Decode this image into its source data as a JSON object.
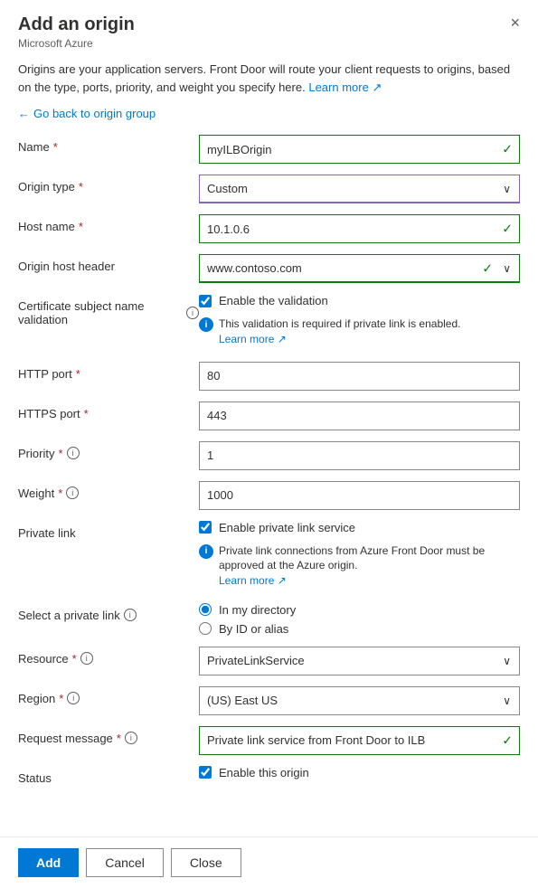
{
  "dialog": {
    "title": "Add an origin",
    "subtitle": "Microsoft Azure",
    "close_label": "×"
  },
  "description": {
    "text": "Origins are your application servers. Front Door will route your client requests to origins, based on the type, ports, priority, and weight you specify here.",
    "learn_more": "Learn more",
    "learn_more_icon": "↗"
  },
  "back_link": {
    "arrow": "←",
    "label": "Go back to origin group"
  },
  "form": {
    "name": {
      "label": "Name",
      "required": true,
      "value": "myILBOrigin"
    },
    "origin_type": {
      "label": "Origin type",
      "required": true,
      "value": "Custom"
    },
    "host_name": {
      "label": "Host name",
      "required": true,
      "value": "10.1.0.6"
    },
    "origin_host_header": {
      "label": "Origin host header",
      "required": false,
      "value": "www.contoso.com"
    },
    "cert_validation": {
      "label": "Certificate subject name validation",
      "has_info": true,
      "checkbox_label": "Enable the validation",
      "checked": true,
      "info_text": "This validation is required if private link is enabled.",
      "learn_more": "Learn more",
      "learn_more_icon": "↗"
    },
    "http_port": {
      "label": "HTTP port",
      "required": true,
      "value": "80"
    },
    "https_port": {
      "label": "HTTPS port",
      "required": true,
      "value": "443"
    },
    "priority": {
      "label": "Priority",
      "required": true,
      "has_info": true,
      "value": "1"
    },
    "weight": {
      "label": "Weight",
      "required": true,
      "has_info": true,
      "value": "1000"
    },
    "private_link": {
      "label": "Private link",
      "checkbox_label": "Enable private link service",
      "checked": true,
      "info_text": "Private link connections from Azure Front Door must be approved at the Azure origin.",
      "learn_more": "Learn more",
      "learn_more_icon": "↗"
    },
    "select_private_link": {
      "label": "Select a private link",
      "has_info": true,
      "options": [
        {
          "label": "In my directory",
          "value": "directory",
          "selected": true
        },
        {
          "label": "By ID or alias",
          "value": "alias",
          "selected": false
        }
      ]
    },
    "resource": {
      "label": "Resource",
      "required": true,
      "has_info": true,
      "value": "PrivateLinkService"
    },
    "region": {
      "label": "Region",
      "required": true,
      "has_info": true,
      "value": "(US) East US"
    },
    "request_message": {
      "label": "Request message",
      "required": true,
      "has_info": true,
      "value": "Private link service from Front Door to ILB"
    },
    "status": {
      "label": "Status",
      "checkbox_label": "Enable this origin",
      "checked": true
    }
  },
  "footer": {
    "add_label": "Add",
    "cancel_label": "Cancel",
    "close_label": "Close"
  }
}
